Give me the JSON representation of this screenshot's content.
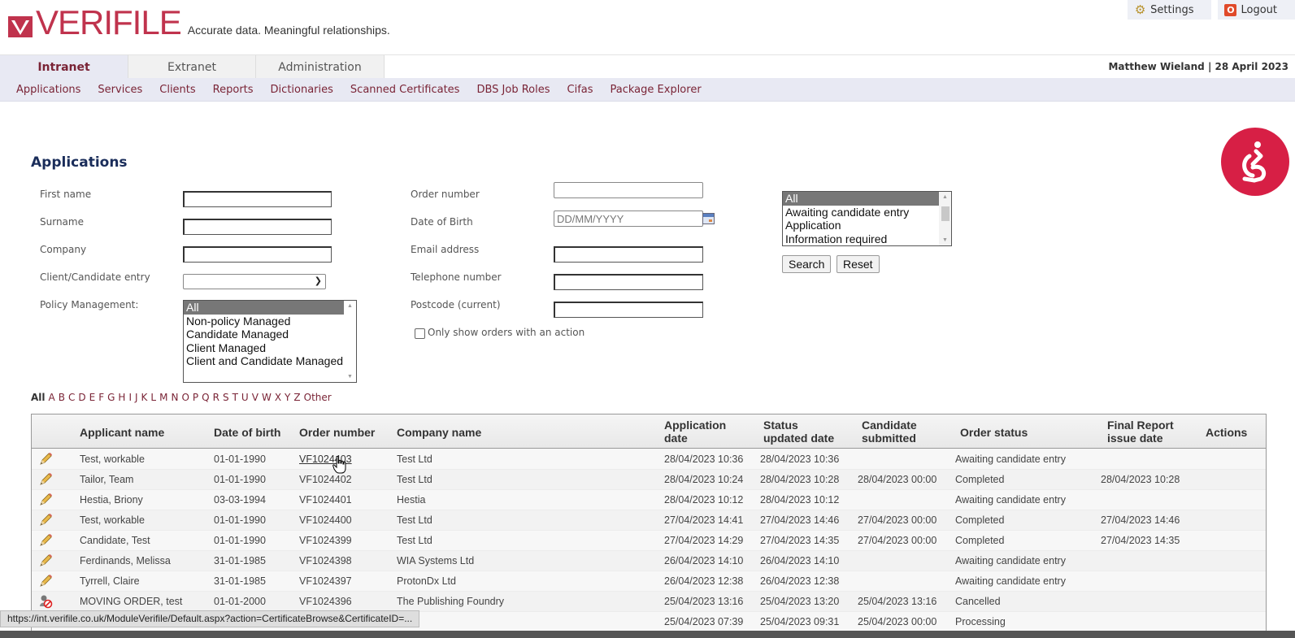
{
  "brand": {
    "name": "VERIFILE",
    "tagline": "Accurate data. Meaningful relationships.",
    "color": "#c0334d"
  },
  "toplinks": [
    {
      "label": "Settings",
      "icon": "gear-icon"
    },
    {
      "label": "Logout",
      "icon": "power-icon"
    }
  ],
  "tabs": [
    {
      "label": "Intranet",
      "active": true
    },
    {
      "label": "Extranet",
      "active": false
    },
    {
      "label": "Administration",
      "active": false
    }
  ],
  "user_info": "Matthew Wieland | 28 April 2023",
  "subnav": [
    "Applications",
    "Services",
    "Clients",
    "Reports",
    "Dictionaries",
    "Scanned Certificates",
    "DBS Job Roles",
    "Cifas",
    "Package Explorer"
  ],
  "page_title": "Applications",
  "form": {
    "first_name": {
      "label": "First name",
      "value": ""
    },
    "surname": {
      "label": "Surname",
      "value": ""
    },
    "company": {
      "label": "Company",
      "value": ""
    },
    "client_candidate_entry": {
      "label": "Client/Candidate entry",
      "value": ""
    },
    "policy_management": {
      "label": "Policy Management:",
      "options": [
        "All",
        "Non-policy Managed",
        "Candidate Managed",
        "Client Managed",
        "Client and Candidate Managed"
      ],
      "selected": "All"
    },
    "order_number": {
      "label": "Order number",
      "value": ""
    },
    "date_of_birth": {
      "label": "Date of Birth",
      "placeholder": "DD/MM/YYYY",
      "value": ""
    },
    "email": {
      "label": "Email address",
      "value": ""
    },
    "telephone": {
      "label": "Telephone number",
      "value": ""
    },
    "postcode": {
      "label": "Postcode (current)",
      "value": ""
    },
    "only_action": {
      "label": "Only show orders with an action",
      "checked": false
    },
    "status_list": {
      "options": [
        "All",
        "Awaiting candidate entry",
        "Application",
        "Information required"
      ],
      "selected": "All"
    },
    "search_label": "Search",
    "reset_label": "Reset"
  },
  "alpha_filter": [
    "All",
    "A",
    "B",
    "C",
    "D",
    "E",
    "F",
    "G",
    "H",
    "I",
    "J",
    "K",
    "L",
    "M",
    "N",
    "O",
    "P",
    "Q",
    "R",
    "S",
    "T",
    "U",
    "V",
    "W",
    "X",
    "Y",
    "Z",
    "Other"
  ],
  "table": {
    "headers": {
      "applicant": "Applicant name",
      "dob": "Date of birth",
      "order": "Order number",
      "company": "Company name",
      "app_date_1": "Application",
      "app_date_2": "date",
      "status_upd_1": "Status",
      "status_upd_2": "updated date",
      "cand_sub_1": "Candidate",
      "cand_sub_2": "submitted",
      "order_status": "Order status",
      "final_1": "Final Report",
      "final_2": "issue date",
      "actions": "Actions"
    },
    "rows": [
      {
        "icon": "pencil-icon",
        "applicant": "Test, workable",
        "dob": "01-01-1990",
        "order": "VF1024403",
        "company": "Test Ltd",
        "app_date": "28/04/2023 10:36",
        "status_updated": "28/04/2023 10:36",
        "candidate_submitted": "",
        "order_status": "Awaiting candidate entry",
        "final_report": ""
      },
      {
        "icon": "pencil-icon",
        "applicant": "Tailor, Team",
        "dob": "01-01-1990",
        "order": "VF1024402",
        "company": "Test Ltd",
        "app_date": "28/04/2023 10:24",
        "status_updated": "28/04/2023 10:28",
        "candidate_submitted": "28/04/2023 00:00",
        "order_status": "Completed",
        "final_report": "28/04/2023 10:28"
      },
      {
        "icon": "pencil-icon",
        "applicant": "Hestia, Briony",
        "dob": "03-03-1994",
        "order": "VF1024401",
        "company": "Hestia",
        "app_date": "28/04/2023 10:12",
        "status_updated": "28/04/2023 10:12",
        "candidate_submitted": "",
        "order_status": "Awaiting candidate entry",
        "final_report": ""
      },
      {
        "icon": "pencil-icon",
        "applicant": "Test, workable",
        "dob": "01-01-1990",
        "order": "VF1024400",
        "company": "Test Ltd",
        "app_date": "27/04/2023 14:41",
        "status_updated": "27/04/2023 14:46",
        "candidate_submitted": "27/04/2023 00:00",
        "order_status": "Completed",
        "final_report": "27/04/2023 14:46"
      },
      {
        "icon": "pencil-icon",
        "applicant": "Candidate, Test",
        "dob": "01-01-1990",
        "order": "VF1024399",
        "company": "Test Ltd",
        "app_date": "27/04/2023 14:29",
        "status_updated": "27/04/2023 14:35",
        "candidate_submitted": "27/04/2023 00:00",
        "order_status": "Completed",
        "final_report": "27/04/2023 14:35"
      },
      {
        "icon": "pencil-icon",
        "applicant": "Ferdinands, Melissa",
        "dob": "31-01-1985",
        "order": "VF1024398",
        "company": "WIA Systems Ltd",
        "app_date": "26/04/2023 14:10",
        "status_updated": "26/04/2023 14:10",
        "candidate_submitted": "",
        "order_status": "Awaiting candidate entry",
        "final_report": ""
      },
      {
        "icon": "pencil-icon",
        "applicant": "Tyrrell, Claire",
        "dob": "31-01-1985",
        "order": "VF1024397",
        "company": "ProtonDx Ltd",
        "app_date": "26/04/2023 12:38",
        "status_updated": "26/04/2023 12:38",
        "candidate_submitted": "",
        "order_status": "Awaiting candidate entry",
        "final_report": ""
      },
      {
        "icon": "cancelled-user-icon",
        "applicant": "MOVING ORDER, test",
        "dob": "01-01-2000",
        "order": "VF1024396",
        "company": "The Publishing Foundry",
        "app_date": "25/04/2023 13:16",
        "status_updated": "25/04/2023 13:20",
        "candidate_submitted": "25/04/2023 13:16",
        "order_status": "Cancelled",
        "final_report": ""
      },
      {
        "icon": "pencil-icon",
        "applicant": "",
        "dob": "",
        "order": "",
        "company": "",
        "app_date": "25/04/2023 07:39",
        "status_updated": "25/04/2023 09:31",
        "candidate_submitted": "25/04/2023 00:00",
        "order_status": "Processing",
        "final_report": ""
      }
    ]
  },
  "status_bar_url": "https://int.verifile.co.uk/ModuleVerifile/Default.aspx?action=CertificateBrowse&CertificateID=..."
}
